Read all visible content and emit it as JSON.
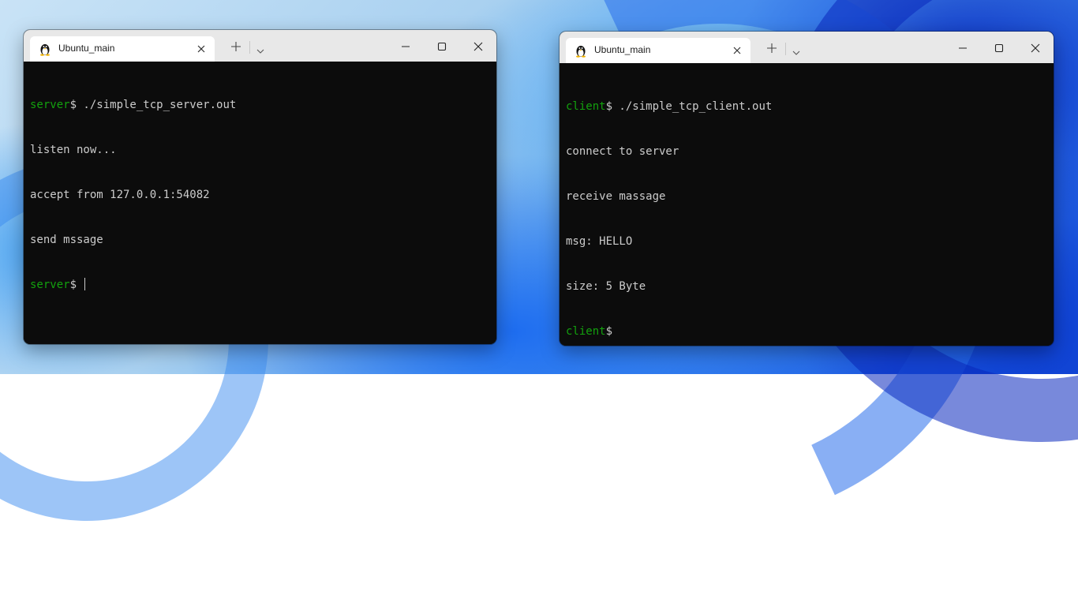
{
  "server_window": {
    "tab_title": "Ubuntu_main",
    "tab_icon": "linux-tux-icon",
    "lines": [
      {
        "prompt": "server",
        "text": "$ ./simple_tcp_server.out"
      },
      {
        "prompt": "",
        "text": "listen now..."
      },
      {
        "prompt": "",
        "text": "accept from 127.0.0.1:54082"
      },
      {
        "prompt": "",
        "text": "send mssage"
      },
      {
        "prompt": "server",
        "text": "$ "
      }
    ]
  },
  "client_window": {
    "tab_title": "Ubuntu_main",
    "tab_icon": "linux-tux-icon",
    "lines": [
      {
        "prompt": "client",
        "text": "$ ./simple_tcp_client.out"
      },
      {
        "prompt": "",
        "text": "connect to server"
      },
      {
        "prompt": "",
        "text": "receive massage"
      },
      {
        "prompt": "",
        "text": "msg: HELLO"
      },
      {
        "prompt": "",
        "text": "size: 5 Byte"
      },
      {
        "prompt": "client",
        "text": "$"
      }
    ]
  },
  "colors": {
    "terminal_bg": "#0c0c0c",
    "terminal_fg": "#cccccc",
    "prompt_green": "#13a10e",
    "titlebar_bg": "#e8e8e8"
  }
}
